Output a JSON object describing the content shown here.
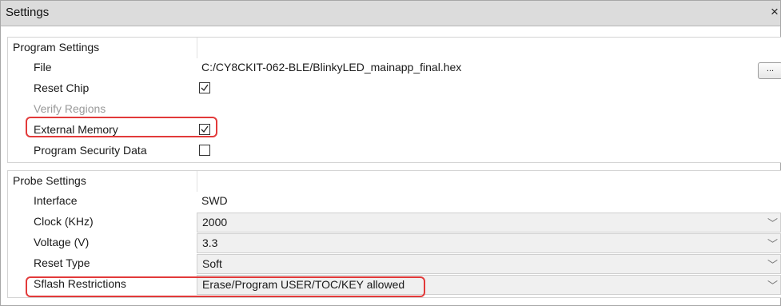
{
  "window": {
    "title": "Settings"
  },
  "program_settings": {
    "header": "Program Settings",
    "file_label": "File",
    "file_value": "C:/CY8CKIT-062-BLE/BlinkyLED_mainapp_final.hex",
    "browse_label": "...",
    "reset_chip_label": "Reset Chip",
    "reset_chip_checked": true,
    "verify_regions_label": "Verify Regions",
    "external_memory_label": "External Memory",
    "external_memory_checked": true,
    "program_security_label": "Program Security Data",
    "program_security_checked": false
  },
  "probe_settings": {
    "header": "Probe Settings",
    "interface_label": "Interface",
    "interface_value": "SWD",
    "clock_label": "Clock (KHz)",
    "clock_value": "2000",
    "voltage_label": "Voltage (V)",
    "voltage_value": "3.3",
    "reset_type_label": "Reset Type",
    "reset_type_value": "Soft",
    "sflash_label": "Sflash Restrictions",
    "sflash_value": "Erase/Program USER/TOC/KEY allowed"
  },
  "colors": {
    "highlight": "#e23a3a",
    "titlebar": "#dcdcdc",
    "dropdown_bg": "#f0f0f0"
  },
  "icons": {
    "close": "close-icon",
    "check": "checkmark-icon",
    "chevron": "chevron-down-icon"
  }
}
